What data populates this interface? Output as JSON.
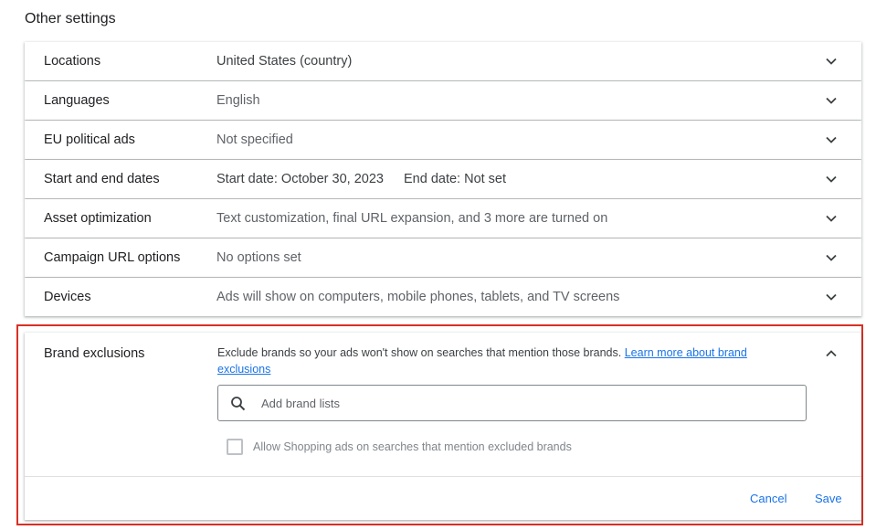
{
  "section_title": "Other settings",
  "rows": [
    {
      "label": "Locations",
      "value": "United States (country)"
    },
    {
      "label": "Languages",
      "value": "English"
    },
    {
      "label": "EU political ads",
      "value": "Not specified"
    },
    {
      "label": "Start and end dates",
      "value_start": "Start date: October 30, 2023",
      "value_end": "End date: Not set"
    },
    {
      "label": "Asset optimization",
      "value": "Text customization, final URL expansion, and 3 more are turned on"
    },
    {
      "label": "Campaign URL options",
      "value": "No options set"
    },
    {
      "label": "Devices",
      "value": "Ads will show on computers, mobile phones, tablets, and TV screens"
    }
  ],
  "brand_exclusions": {
    "label": "Brand exclusions",
    "description": "Exclude brands so your ads won't show on searches that mention those brands.",
    "learn_more": "Learn more about brand exclusions",
    "search_placeholder": "Add brand lists",
    "checkbox_label": "Allow Shopping ads on searches that mention excluded brands",
    "checkbox_checked": false,
    "cancel_label": "Cancel",
    "save_label": "Save"
  },
  "colors": {
    "highlight_border": "#d93025",
    "link": "#1a73e8"
  },
  "icons": {
    "collapsed": "chevron-down-icon",
    "expanded": "chevron-up-icon",
    "search": "search-icon"
  }
}
